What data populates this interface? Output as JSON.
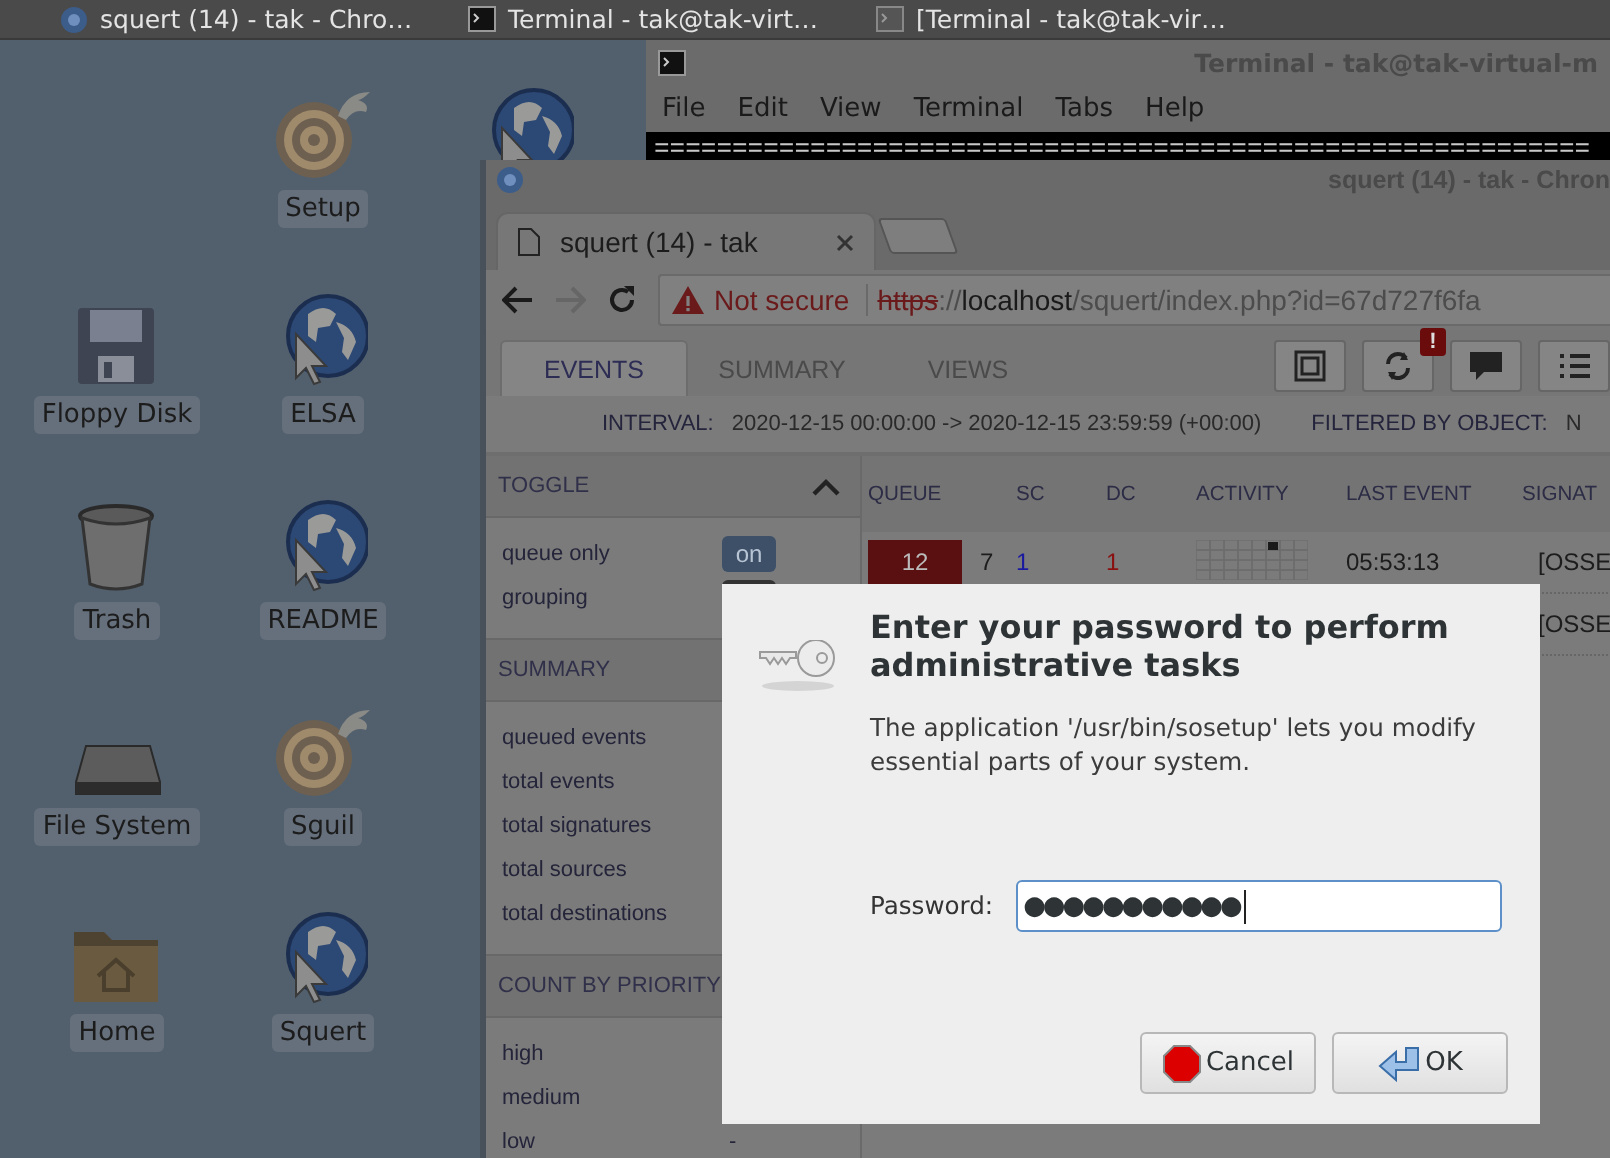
{
  "taskbar": {
    "items": [
      {
        "kind": "chrome",
        "title": "squert (14) - tak - Chro…"
      },
      {
        "kind": "terminal",
        "title": "Terminal - tak@tak-virt…"
      },
      {
        "kind": "terminal-inactive",
        "title": "[Terminal - tak@tak-vir…"
      }
    ]
  },
  "desktop": {
    "columns": [
      [
        {
          "kind": "floppy",
          "label": "Floppy Disk"
        },
        {
          "kind": "trash",
          "label": "Trash"
        },
        {
          "kind": "drive",
          "label": "File System"
        },
        {
          "kind": "home",
          "label": "Home"
        }
      ],
      [
        {
          "kind": "onion",
          "label": "Setup"
        },
        {
          "kind": "globe",
          "label": "ELSA"
        },
        {
          "kind": "globe",
          "label": "README"
        },
        {
          "kind": "onion",
          "label": "Sguil"
        },
        {
          "kind": "globe",
          "label": "Squert"
        }
      ],
      [
        {
          "kind": "globe"
        }
      ]
    ]
  },
  "terminal": {
    "title": "Terminal - tak@tak-virtual-m",
    "menu": [
      "File",
      "Edit",
      "View",
      "Terminal",
      "Tabs",
      "Help"
    ],
    "output": "============================================================"
  },
  "browser": {
    "title": "squert (14) - tak - Chron",
    "tab": {
      "title": "squert (14) - tak"
    },
    "address": {
      "security": "Not secure",
      "scheme": "https",
      "host": "://localhost",
      "path": "/squert/index.php?id=67d727f6fa"
    },
    "page": {
      "nav_tabs": [
        {
          "label": "EVENTS",
          "selected": true
        },
        {
          "label": "SUMMARY",
          "selected": false
        },
        {
          "label": "VIEWS",
          "selected": false
        }
      ],
      "toolbar": [
        {
          "kind": "square"
        },
        {
          "kind": "refresh",
          "badge": "!"
        },
        {
          "kind": "comment"
        },
        {
          "kind": "list"
        }
      ],
      "interval": {
        "label": "INTERVAL:",
        "value": "2020-12-15 00:00:00 -> 2020-12-15 23:59:59 (+00:00)"
      },
      "filter": {
        "label": "FILTERED BY OBJECT:",
        "value": "N"
      },
      "sidebar": [
        {
          "title": "TOGGLE",
          "expanded": true,
          "items": [
            {
              "label": "queue only",
              "kind": "toggle",
              "value": "on"
            },
            {
              "label": "grouping",
              "kind": "toggle"
            }
          ]
        },
        {
          "title": "SUMMARY",
          "items": [
            {
              "label": "queued events"
            },
            {
              "label": "total events"
            },
            {
              "label": "total signatures"
            },
            {
              "label": "total sources"
            },
            {
              "label": "total destinations"
            }
          ]
        },
        {
          "title": "COUNT BY PRIORITY",
          "items": [
            {
              "label": "high"
            },
            {
              "label": "medium"
            },
            {
              "label": "low",
              "value": "-"
            }
          ]
        }
      ],
      "table": {
        "columns": [
          "QUEUE",
          "SC",
          "DC",
          "ACTIVITY",
          "LAST EVENT",
          "SIGNAT"
        ],
        "rows": [
          {
            "queue": "12",
            "count": "7",
            "sc": "1",
            "dc": "1",
            "activity": true,
            "last_event": "05:53:13",
            "signature": "[OSSE"
          },
          {
            "signature": "[OSSE"
          }
        ]
      }
    }
  },
  "dialog": {
    "title": "Enter your password to perform administrative tasks",
    "message": "The application '/usr/bin/sosetup' lets you modify essential parts of your system.",
    "password_label": "Password:",
    "password_value": "●●●●●●●●●●●",
    "buttons": [
      {
        "kind": "cancel",
        "label": "Cancel"
      },
      {
        "kind": "ok",
        "label": "OK"
      }
    ]
  }
}
